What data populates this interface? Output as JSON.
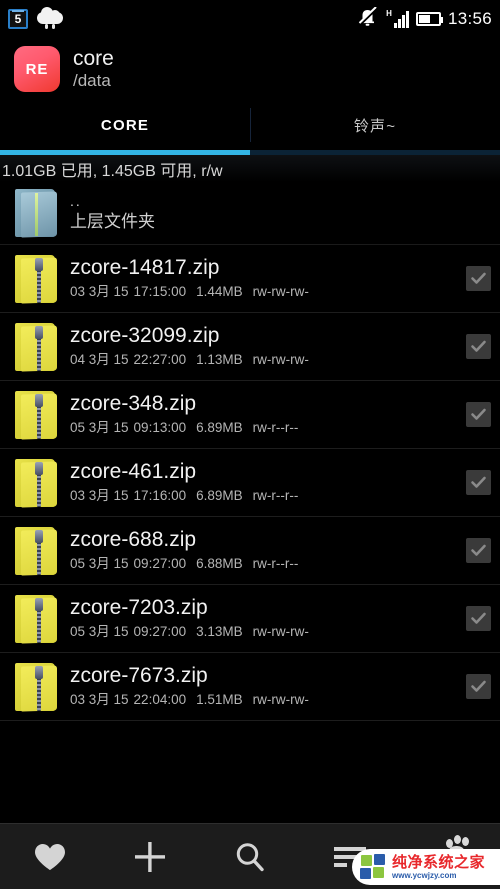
{
  "statusbar": {
    "calendar_day": "5",
    "weather_icon": "rain-cloud-icon",
    "mute_icon": "bell-muted-icon",
    "signal_label": "H",
    "signal_icon": "signal-bars-icon",
    "battery_icon": "battery-icon",
    "time": "13:56"
  },
  "header": {
    "app_badge": "RE",
    "title": "core",
    "path": "/data"
  },
  "tabs": [
    {
      "label": "CORE",
      "active": true
    },
    {
      "label": "铃声~",
      "active": false
    }
  ],
  "storage": {
    "text": "1.01GB 已用, 1.45GB 可用, r/w"
  },
  "parent_row": {
    "name": "..",
    "description": "上层文件夹",
    "icon": "folder-blue-icon"
  },
  "files": [
    {
      "name": "zcore-14817.zip",
      "date": "03 3月 15",
      "time": "17:15:00",
      "size": "1.44MB",
      "perms": "rw-rw-rw-",
      "icon": "zip-folder-icon",
      "checked": true
    },
    {
      "name": "zcore-32099.zip",
      "date": "04 3月 15",
      "time": "22:27:00",
      "size": "1.13MB",
      "perms": "rw-rw-rw-",
      "icon": "zip-folder-icon",
      "checked": true
    },
    {
      "name": "zcore-348.zip",
      "date": "05 3月 15",
      "time": "09:13:00",
      "size": "6.89MB",
      "perms": "rw-r--r--",
      "icon": "zip-folder-icon",
      "checked": true
    },
    {
      "name": "zcore-461.zip",
      "date": "03 3月 15",
      "time": "17:16:00",
      "size": "6.89MB",
      "perms": "rw-r--r--",
      "icon": "zip-folder-icon",
      "checked": true
    },
    {
      "name": "zcore-688.zip",
      "date": "05 3月 15",
      "time": "09:27:00",
      "size": "6.88MB",
      "perms": "rw-r--r--",
      "icon": "zip-folder-icon",
      "checked": true
    },
    {
      "name": "zcore-7203.zip",
      "date": "05 3月 15",
      "time": "09:27:00",
      "size": "3.13MB",
      "perms": "rw-rw-rw-",
      "icon": "zip-folder-icon",
      "checked": true
    },
    {
      "name": "zcore-7673.zip",
      "date": "03 3月 15",
      "time": "22:04:00",
      "size": "1.51MB",
      "perms": "rw-rw-rw-",
      "icon": "zip-folder-icon",
      "checked": true
    }
  ],
  "toolbar": {
    "buttons": [
      {
        "icon": "heart-icon",
        "name": "favorites-button"
      },
      {
        "icon": "plus-icon",
        "name": "add-button"
      },
      {
        "icon": "search-icon",
        "name": "search-button"
      },
      {
        "icon": "sort-icon",
        "name": "sort-button"
      }
    ]
  },
  "watermark": {
    "title": "纯净系统之家",
    "url": "www.ycwjzy.com"
  },
  "colors": {
    "accent": "#33b5e5",
    "app_badge": "#ff5a6e",
    "background": "#000000",
    "folder_zip": "#f2ec5a",
    "folder_parent": "#8fb7c9",
    "toolbar": "#1c1c1c"
  }
}
